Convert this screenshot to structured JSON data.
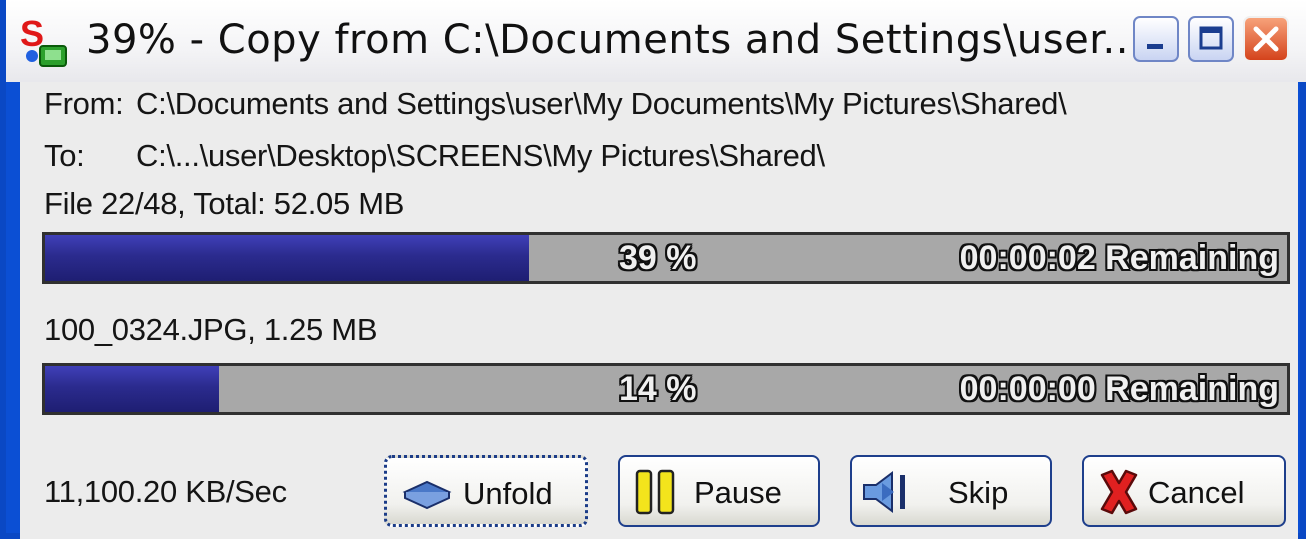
{
  "window": {
    "title": "39% - Copy from C:\\Documents and Settings\\user...",
    "app_icon": "copy-app-icon",
    "controls": [
      "minimize-icon",
      "maximize-icon",
      "close-icon"
    ]
  },
  "info": {
    "from_label": "From:",
    "from_path": "C:\\Documents and Settings\\user\\My Documents\\My Pictures\\Shared\\",
    "to_label": "To:",
    "to_path": "C:\\...\\user\\Desktop\\SCREENS\\My Pictures\\Shared\\",
    "file_status": "File 22/48, Total: 52.05 MB"
  },
  "total_progress": {
    "percent": 39,
    "percent_text": "39 %",
    "remaining_text": "00:00:02 Remaining"
  },
  "current_file": {
    "name_size": "100_0324.JPG, 1.25 MB",
    "percent": 14,
    "percent_text": "14 %",
    "remaining_text": "00:00:00 Remaining"
  },
  "speed": "11,100.20 KB/Sec",
  "buttons": {
    "unfold": "Unfold",
    "pause": "Pause",
    "skip": "Skip",
    "cancel": "Cancel"
  },
  "colors": {
    "progress_fill": "#2b2b8e",
    "progress_track": "#a8a8a8",
    "titlebar_close": "#d4431c"
  }
}
